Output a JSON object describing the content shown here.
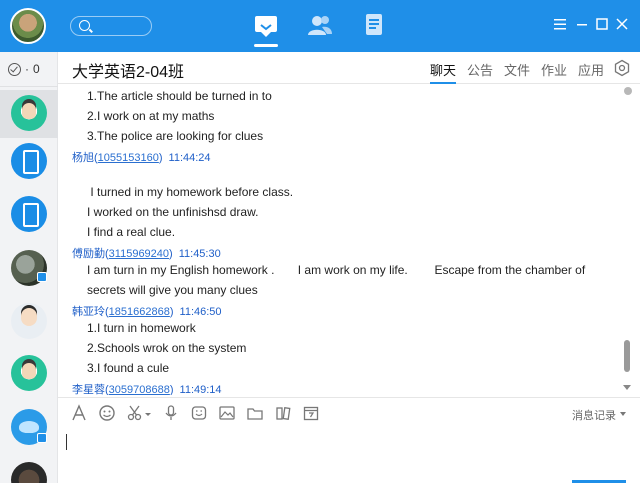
{
  "app": {
    "accent_color": "#1f8fe8",
    "search_icon": "search-icon",
    "nav_icons": [
      "messages-icon",
      "contacts-icon",
      "space-icon"
    ],
    "window_controls": [
      "menu-icon",
      "minimize-icon",
      "maximize-icon",
      "close-icon"
    ]
  },
  "sidebar": {
    "done_count": "0"
  },
  "chat": {
    "title": "大学英语2-04班",
    "tabs": [
      {
        "label": "聊天",
        "active": true
      },
      {
        "label": "公告"
      },
      {
        "label": "文件"
      },
      {
        "label": "作业"
      },
      {
        "label": "应用"
      }
    ]
  },
  "messages": {
    "lines": [
      "1.The article should be turned in to",
      "2.I work on at my maths",
      "3.The police are looking for clues",
      " I turned in my homework before class.",
      "I worked on the unfinishsd draw.",
      "I find a real clue.",
      "I am turn in my English homework .       I am work on my life.        Escape from the chamber of",
      "secrets will give you many clues",
      "1.I turn in homework",
      "2.Schools wrok on the system",
      "3.I found a cule"
    ],
    "senders": [
      {
        "name": "杨旭",
        "qq": "1055153160",
        "time": "11:44:24"
      },
      {
        "name": "傅励勤",
        "qq": "3115969240",
        "time": "11:45:30"
      },
      {
        "name": "韩亚玲",
        "qq": "1851662868",
        "time": "11:46:50"
      },
      {
        "name": "李星蓉",
        "qq": "3059708688",
        "time": "11:49:14"
      }
    ]
  },
  "toolbar": {
    "history_label": "消息记录"
  }
}
